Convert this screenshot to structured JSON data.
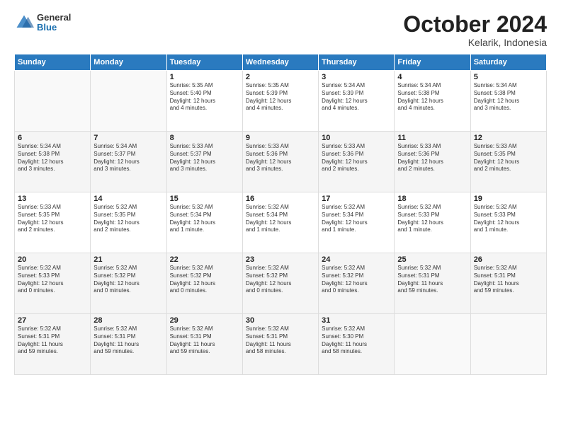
{
  "header": {
    "logo_general": "General",
    "logo_blue": "Blue",
    "month_title": "October 2024",
    "location": "Kelarik, Indonesia"
  },
  "weekdays": [
    "Sunday",
    "Monday",
    "Tuesday",
    "Wednesday",
    "Thursday",
    "Friday",
    "Saturday"
  ],
  "weeks": [
    [
      {
        "day": "",
        "info": ""
      },
      {
        "day": "",
        "info": ""
      },
      {
        "day": "1",
        "info": "Sunrise: 5:35 AM\nSunset: 5:40 PM\nDaylight: 12 hours\nand 4 minutes."
      },
      {
        "day": "2",
        "info": "Sunrise: 5:35 AM\nSunset: 5:39 PM\nDaylight: 12 hours\nand 4 minutes."
      },
      {
        "day": "3",
        "info": "Sunrise: 5:34 AM\nSunset: 5:39 PM\nDaylight: 12 hours\nand 4 minutes."
      },
      {
        "day": "4",
        "info": "Sunrise: 5:34 AM\nSunset: 5:38 PM\nDaylight: 12 hours\nand 4 minutes."
      },
      {
        "day": "5",
        "info": "Sunrise: 5:34 AM\nSunset: 5:38 PM\nDaylight: 12 hours\nand 3 minutes."
      }
    ],
    [
      {
        "day": "6",
        "info": "Sunrise: 5:34 AM\nSunset: 5:38 PM\nDaylight: 12 hours\nand 3 minutes."
      },
      {
        "day": "7",
        "info": "Sunrise: 5:34 AM\nSunset: 5:37 PM\nDaylight: 12 hours\nand 3 minutes."
      },
      {
        "day": "8",
        "info": "Sunrise: 5:33 AM\nSunset: 5:37 PM\nDaylight: 12 hours\nand 3 minutes."
      },
      {
        "day": "9",
        "info": "Sunrise: 5:33 AM\nSunset: 5:36 PM\nDaylight: 12 hours\nand 3 minutes."
      },
      {
        "day": "10",
        "info": "Sunrise: 5:33 AM\nSunset: 5:36 PM\nDaylight: 12 hours\nand 2 minutes."
      },
      {
        "day": "11",
        "info": "Sunrise: 5:33 AM\nSunset: 5:36 PM\nDaylight: 12 hours\nand 2 minutes."
      },
      {
        "day": "12",
        "info": "Sunrise: 5:33 AM\nSunset: 5:35 PM\nDaylight: 12 hours\nand 2 minutes."
      }
    ],
    [
      {
        "day": "13",
        "info": "Sunrise: 5:33 AM\nSunset: 5:35 PM\nDaylight: 12 hours\nand 2 minutes."
      },
      {
        "day": "14",
        "info": "Sunrise: 5:32 AM\nSunset: 5:35 PM\nDaylight: 12 hours\nand 2 minutes."
      },
      {
        "day": "15",
        "info": "Sunrise: 5:32 AM\nSunset: 5:34 PM\nDaylight: 12 hours\nand 1 minute."
      },
      {
        "day": "16",
        "info": "Sunrise: 5:32 AM\nSunset: 5:34 PM\nDaylight: 12 hours\nand 1 minute."
      },
      {
        "day": "17",
        "info": "Sunrise: 5:32 AM\nSunset: 5:34 PM\nDaylight: 12 hours\nand 1 minute."
      },
      {
        "day": "18",
        "info": "Sunrise: 5:32 AM\nSunset: 5:33 PM\nDaylight: 12 hours\nand 1 minute."
      },
      {
        "day": "19",
        "info": "Sunrise: 5:32 AM\nSunset: 5:33 PM\nDaylight: 12 hours\nand 1 minute."
      }
    ],
    [
      {
        "day": "20",
        "info": "Sunrise: 5:32 AM\nSunset: 5:33 PM\nDaylight: 12 hours\nand 0 minutes."
      },
      {
        "day": "21",
        "info": "Sunrise: 5:32 AM\nSunset: 5:32 PM\nDaylight: 12 hours\nand 0 minutes."
      },
      {
        "day": "22",
        "info": "Sunrise: 5:32 AM\nSunset: 5:32 PM\nDaylight: 12 hours\nand 0 minutes."
      },
      {
        "day": "23",
        "info": "Sunrise: 5:32 AM\nSunset: 5:32 PM\nDaylight: 12 hours\nand 0 minutes."
      },
      {
        "day": "24",
        "info": "Sunrise: 5:32 AM\nSunset: 5:32 PM\nDaylight: 12 hours\nand 0 minutes."
      },
      {
        "day": "25",
        "info": "Sunrise: 5:32 AM\nSunset: 5:31 PM\nDaylight: 11 hours\nand 59 minutes."
      },
      {
        "day": "26",
        "info": "Sunrise: 5:32 AM\nSunset: 5:31 PM\nDaylight: 11 hours\nand 59 minutes."
      }
    ],
    [
      {
        "day": "27",
        "info": "Sunrise: 5:32 AM\nSunset: 5:31 PM\nDaylight: 11 hours\nand 59 minutes."
      },
      {
        "day": "28",
        "info": "Sunrise: 5:32 AM\nSunset: 5:31 PM\nDaylight: 11 hours\nand 59 minutes."
      },
      {
        "day": "29",
        "info": "Sunrise: 5:32 AM\nSunset: 5:31 PM\nDaylight: 11 hours\nand 59 minutes."
      },
      {
        "day": "30",
        "info": "Sunrise: 5:32 AM\nSunset: 5:31 PM\nDaylight: 11 hours\nand 58 minutes."
      },
      {
        "day": "31",
        "info": "Sunrise: 5:32 AM\nSunset: 5:30 PM\nDaylight: 11 hours\nand 58 minutes."
      },
      {
        "day": "",
        "info": ""
      },
      {
        "day": "",
        "info": ""
      }
    ]
  ]
}
